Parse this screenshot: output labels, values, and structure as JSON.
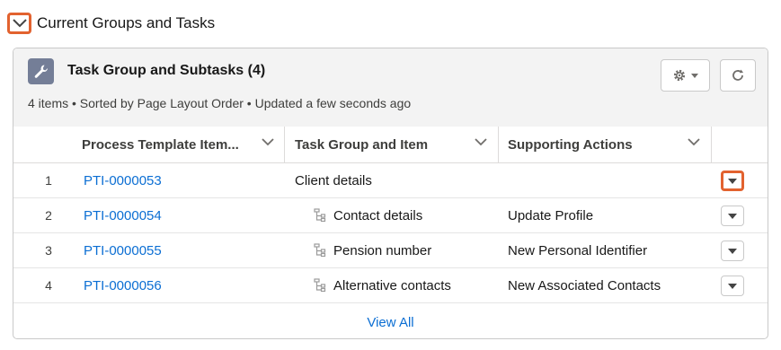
{
  "section": {
    "title": "Current Groups and Tasks"
  },
  "card": {
    "title": "Task Group and Subtasks (4)",
    "meta": "4 items • Sorted by Page Layout Order • Updated a few seconds ago"
  },
  "columns": [
    "Process Template Item...",
    "Task Group and Item",
    "Supporting Actions"
  ],
  "rows": [
    {
      "num": "1",
      "id": "PTI-0000053",
      "task": "Client details",
      "action": ""
    },
    {
      "num": "2",
      "id": "PTI-0000054",
      "task": "Contact details",
      "action": "Update Profile"
    },
    {
      "num": "3",
      "id": "PTI-0000055",
      "task": "Pension number",
      "action": "New Personal Identifier"
    },
    {
      "num": "4",
      "id": "PTI-0000056",
      "task": "Alternative contacts",
      "action": "New Associated Contacts"
    }
  ],
  "footer": {
    "view_all": "View All"
  },
  "colors": {
    "accent_highlight": "#e2622f",
    "link": "#0b6ed3",
    "icon_bg": "#747e97"
  },
  "icons": {
    "toggle": "chevron-down-icon",
    "card": "wrench-icon",
    "settings": "gear-icon",
    "refresh": "refresh-icon",
    "sort": "chevron-down-icon",
    "subtask": "hierarchy-icon",
    "row_menu": "caret-down-icon"
  }
}
